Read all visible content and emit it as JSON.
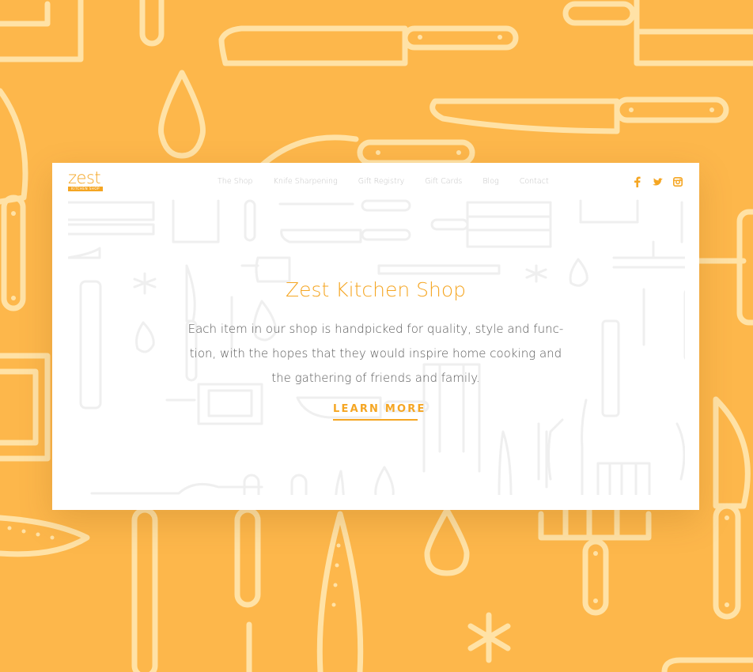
{
  "logo": {
    "word": "zest",
    "tagline": "KITCHEN SHOP"
  },
  "nav": {
    "items": [
      "The Shop",
      "Knife Sharpening",
      "Gift Registry",
      "Gift Cards",
      "Blog",
      "Contact"
    ]
  },
  "social": {
    "icons": [
      "facebook-icon",
      "twitter-icon",
      "instagram-icon"
    ]
  },
  "hero": {
    "title": "Zest Kitchen Shop",
    "line1": "Each item in our shop is handpicked for quality, style and func-",
    "line2": "tion, with the hopes that they would inspire home cooking and",
    "line3": "the gathering of friends and family.",
    "cta": "LEARN MORE"
  },
  "colors": {
    "accent": "#F5A623",
    "background": "#FDB74B",
    "card": "#FFFFFF",
    "pattern_stroke": "#FFE2A6",
    "card_pattern_stroke": "#F0F0F0"
  }
}
